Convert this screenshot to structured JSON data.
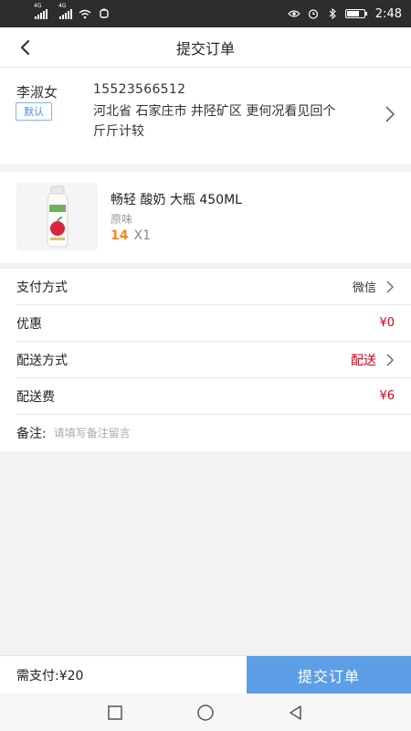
{
  "status_bar": {
    "time": "2:48",
    "network_1": "4G",
    "network_2": "4G"
  },
  "header": {
    "title": "提交订单"
  },
  "address": {
    "name": "李淑女",
    "default_label": "默认",
    "phone": "15523566512",
    "full_address": "河北省 石家庄市 井陉矿区 更何况看见回个斤斤计较"
  },
  "product": {
    "name": "畅轻 酸奶 大瓶 450ML",
    "spec": "原味",
    "price": "14",
    "quantity": "X1",
    "image_icon": "yogurt-bottle"
  },
  "order_rows": {
    "payment_label": "支付方式",
    "payment_value": "微信",
    "discount_label": "优惠",
    "discount_value": "¥0",
    "delivery_label": "配送方式",
    "delivery_value": "配送",
    "fee_label": "配送费",
    "fee_value": "¥6",
    "note_label": "备注:",
    "note_placeholder": "请填写备注留言"
  },
  "footer": {
    "total_text": "需支付:¥20",
    "submit_label": "提交订单"
  },
  "colors": {
    "accent_blue": "#5d9fe6",
    "price_orange": "#f08a24",
    "value_red": "#d0021b"
  }
}
